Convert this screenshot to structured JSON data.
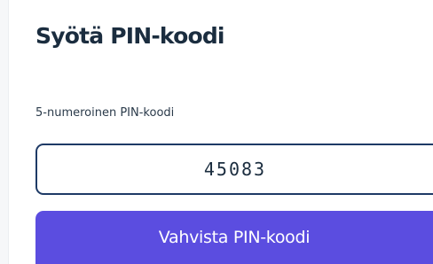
{
  "page": {
    "title": "Syötä PIN-koodi"
  },
  "pin_field": {
    "label": "5-numeroinen PIN-koodi",
    "value": "45083"
  },
  "confirm_button": {
    "label": "Vahvista PIN-koodi"
  },
  "colors": {
    "accent": "#5b4de0",
    "input_border": "#1e3a66",
    "title_text": "#1b2d3f"
  }
}
